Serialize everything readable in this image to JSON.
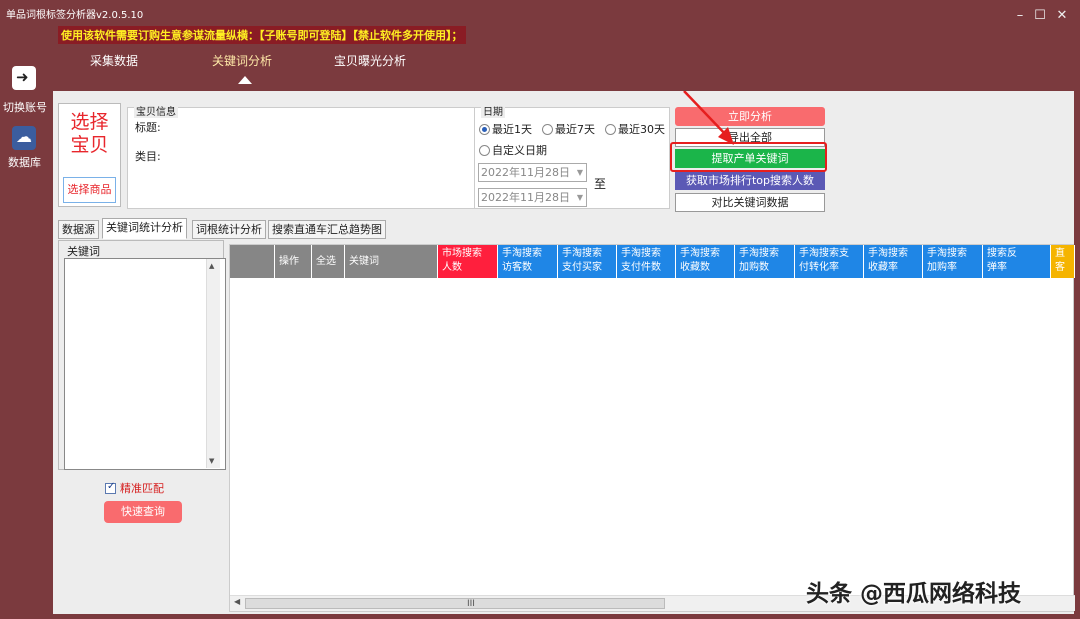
{
  "app": {
    "title": "单品词根标签分析器v2.0.5.10",
    "notice": "使用该软件需要订购生意参谋流量纵横：【子账号即可登陆】【禁止软件多开使用】；",
    "window_controls": {
      "minimize": "–",
      "maximize": "☐",
      "close": "✕"
    }
  },
  "nav": {
    "tabs": [
      {
        "label": "采集数据"
      },
      {
        "label": "关键词分析",
        "active": true
      },
      {
        "label": "宝贝曝光分析"
      }
    ]
  },
  "rail": {
    "switch_account": {
      "label": "切换账号",
      "icon": "switch-account-icon"
    },
    "database": {
      "label": "数据库",
      "icon": "database-icon"
    }
  },
  "product": {
    "select_title": "选择\n宝贝",
    "select_button": "选择商品",
    "info_legend": "宝贝信息",
    "title_label": "标题:",
    "category_label": "类目:"
  },
  "date": {
    "legend": "日期",
    "options": [
      "最近1天",
      "最近7天",
      "最近30天",
      "自定义日期"
    ],
    "selected": "最近1天",
    "from": "2022年11月28日",
    "to": "2022年11月28日",
    "to_label": "至"
  },
  "actions": {
    "analyze": "立即分析",
    "export_all": "导出全部",
    "extract": "提取产单关键词",
    "top_search": "获取市场排行top搜索人数",
    "compare": "对比关键词数据"
  },
  "inner_tabs": [
    "数据源",
    "关键词统计分析",
    "词根统计分析",
    "搜索直通车汇总趋势图"
  ],
  "keyword_panel": {
    "legend": "关键词",
    "exact_match": "精准匹配",
    "quick_query": "快速查询"
  },
  "grid": {
    "columns": [
      {
        "label": "操作",
        "color": "#868686"
      },
      {
        "label": "全选",
        "color": "#868686"
      },
      {
        "label": "关键词",
        "color": "#868686"
      },
      {
        "label": "市场搜索\n人数",
        "color": "#ff1f3d"
      },
      {
        "label": "手淘搜索\n访客数",
        "color": "#1f86e6"
      },
      {
        "label": "手淘搜索\n支付买家",
        "color": "#1f86e6"
      },
      {
        "label": "手淘搜索\n支付件数",
        "color": "#1f86e6"
      },
      {
        "label": "手淘搜索\n收藏数",
        "color": "#1f86e6"
      },
      {
        "label": "手淘搜索\n加购数",
        "color": "#1f86e6"
      },
      {
        "label": "手淘搜索支\n付转化率",
        "color": "#1f86e6"
      },
      {
        "label": "手淘搜索\n收藏率",
        "color": "#1f86e6"
      },
      {
        "label": "手淘搜索\n加购率",
        "color": "#1f86e6"
      },
      {
        "label": "搜索反\n弹率",
        "color": "#1f86e6"
      },
      {
        "label": "直\n客",
        "color": "#f5b400"
      }
    ],
    "scroll_grip": "III"
  },
  "watermark": "头条 @西瓜网络科技",
  "colors": {
    "frame": "#7b3a3e",
    "notice_text": "#ffee22",
    "accent_red": "#f96b6e",
    "extract_green": "#1bb54a",
    "top_search_purple": "#5b59b5",
    "highlight": "#e61e1e"
  }
}
